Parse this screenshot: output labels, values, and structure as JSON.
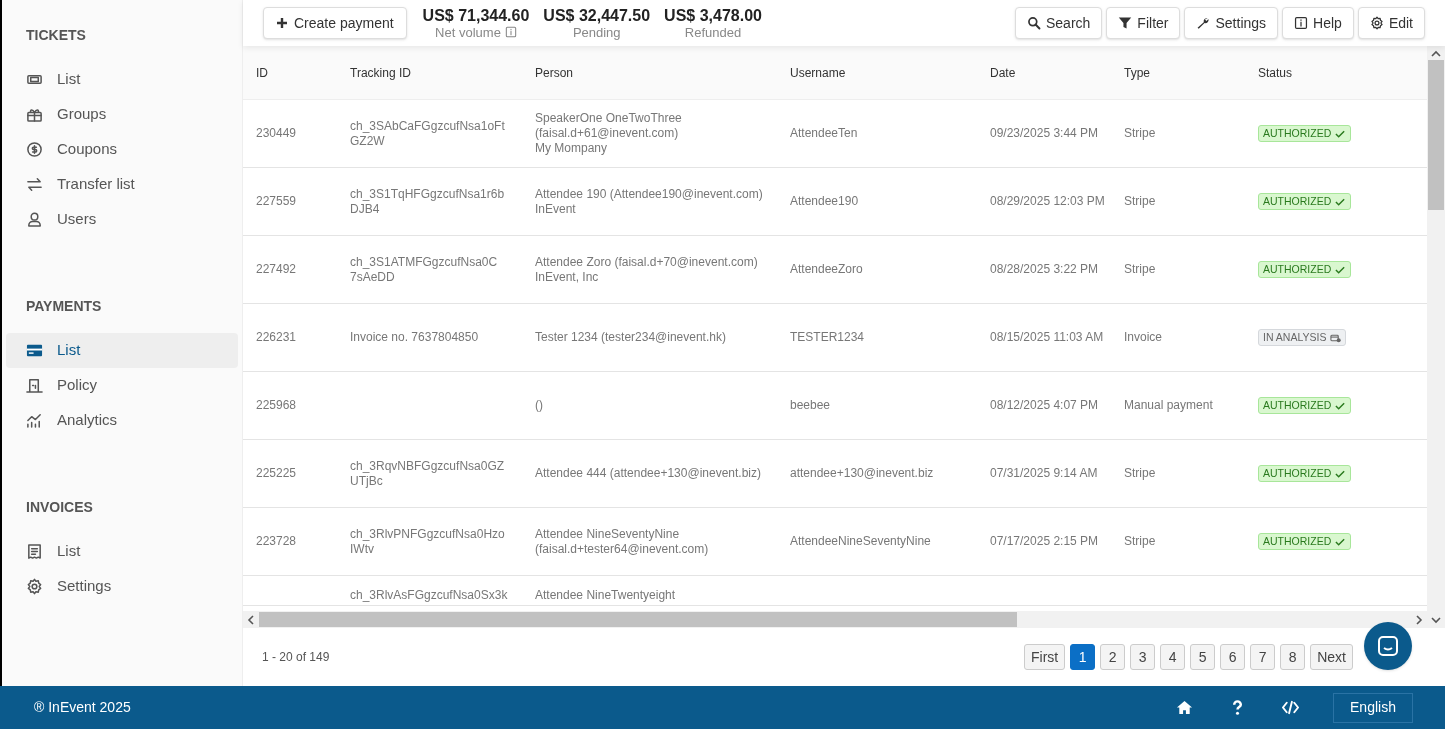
{
  "sidebar": {
    "sections": [
      {
        "title": "TICKETS",
        "items": [
          {
            "label": "List",
            "selected": false
          },
          {
            "label": "Groups",
            "selected": false
          },
          {
            "label": "Coupons",
            "selected": false
          },
          {
            "label": "Transfer list",
            "selected": false
          },
          {
            "label": "Users",
            "selected": false
          }
        ]
      },
      {
        "title": "PAYMENTS",
        "items": [
          {
            "label": "List",
            "selected": true
          },
          {
            "label": "Policy",
            "selected": false
          },
          {
            "label": "Analytics",
            "selected": false
          }
        ]
      },
      {
        "title": "INVOICES",
        "items": [
          {
            "label": "List",
            "selected": false
          },
          {
            "label": "Settings",
            "selected": false
          }
        ]
      }
    ]
  },
  "toolbar": {
    "create_button": "Create payment",
    "stats": [
      {
        "value": "US$ 71,344.60",
        "label": "Net volume",
        "info": true
      },
      {
        "value": "US$ 32,447.50",
        "label": "Pending",
        "info": false
      },
      {
        "value": "US$ 3,478.00",
        "label": "Refunded",
        "info": false
      }
    ],
    "actions": [
      "Search",
      "Filter",
      "Settings",
      "Help",
      "Edit"
    ]
  },
  "table": {
    "columns": [
      "ID",
      "Tracking ID",
      "Person",
      "Username",
      "Date",
      "Type",
      "Status"
    ],
    "rows": [
      {
        "id": "230449",
        "tracking_id": "ch_3SAbCaFGgzcufNsa1oFt GZ2W",
        "person": [
          "SpeakerOne OneTwoThree",
          "(faisal.d+61@inevent.com)",
          "My Mompany"
        ],
        "username": "AttendeeTen",
        "date": "09/23/2025 3:44 PM",
        "type": "Stripe",
        "status": {
          "label": "AUTHORIZED",
          "kind": "authorized"
        }
      },
      {
        "id": "227559",
        "tracking_id": "ch_3S1TqHFGgzcufNsa1r6b DJB4",
        "person": [
          "Attendee 190 (Attendee190@inevent.com)",
          "InEvent"
        ],
        "username": "Attendee190",
        "date": "08/29/2025 12:03 PM",
        "type": "Stripe",
        "status": {
          "label": "AUTHORIZED",
          "kind": "authorized"
        }
      },
      {
        "id": "227492",
        "tracking_id": "ch_3S1ATMFGgzcufNsa0C 7sAeDD",
        "person": [
          "Attendee Zoro (faisal.d+70@inevent.com)",
          "InEvent, Inc"
        ],
        "username": "AttendeeZoro",
        "date": "08/28/2025 3:22 PM",
        "type": "Stripe",
        "status": {
          "label": "AUTHORIZED",
          "kind": "authorized"
        }
      },
      {
        "id": "226231",
        "tracking_id": "Invoice no. 7637804850",
        "person": [
          "Tester 1234 (tester234@inevent.hk)"
        ],
        "username": "TESTER1234",
        "date": "08/15/2025 11:03 AM",
        "type": "Invoice",
        "status": {
          "label": "IN ANALYSIS",
          "kind": "in_analysis"
        }
      },
      {
        "id": "225968",
        "person": [
          "()"
        ],
        "username": "beebee",
        "date": "08/12/2025 4:07 PM",
        "type": "Manual payment",
        "status": {
          "label": "AUTHORIZED",
          "kind": "authorized"
        }
      },
      {
        "id": "225225",
        "tracking_id": "ch_3RqvNBFGgzcufNsa0GZ UTjBc",
        "person": [
          "Attendee 444 (attendee+130@inevent.biz)"
        ],
        "username": "attendee+130@inevent.biz",
        "date": "07/31/2025 9:14 AM",
        "type": "Stripe",
        "status": {
          "label": "AUTHORIZED",
          "kind": "authorized"
        }
      },
      {
        "id": "223728",
        "tracking_id": "ch_3RlvPNFGgzcufNsa0Hzo IWtv",
        "person": [
          "Attendee NineSeventyNine",
          "(faisal.d+tester64@inevent.com)"
        ],
        "username": "AttendeeNineSeventyNine",
        "date": "07/17/2025 2:15 PM",
        "type": "Stripe",
        "status": {
          "label": "AUTHORIZED",
          "kind": "authorized"
        }
      },
      {
        "tracking_id": "ch_3RlvAsFGgzcufNsa0Sx3k",
        "person": [
          "Attendee NineTwentyeight"
        ]
      }
    ]
  },
  "pagination": {
    "range": "1 - 20 of 149",
    "pages": [
      {
        "label": "First",
        "selected": false
      },
      {
        "label": "1",
        "selected": true
      },
      {
        "label": "2",
        "selected": false
      },
      {
        "label": "3",
        "selected": false
      },
      {
        "label": "4",
        "selected": false
      },
      {
        "label": "5",
        "selected": false
      },
      {
        "label": "6",
        "selected": false
      },
      {
        "label": "7",
        "selected": false
      },
      {
        "label": "8",
        "selected": false
      },
      {
        "label": "Next",
        "selected": false
      }
    ]
  },
  "footer": {
    "copyright": "® InEvent 2025",
    "language": "English"
  }
}
